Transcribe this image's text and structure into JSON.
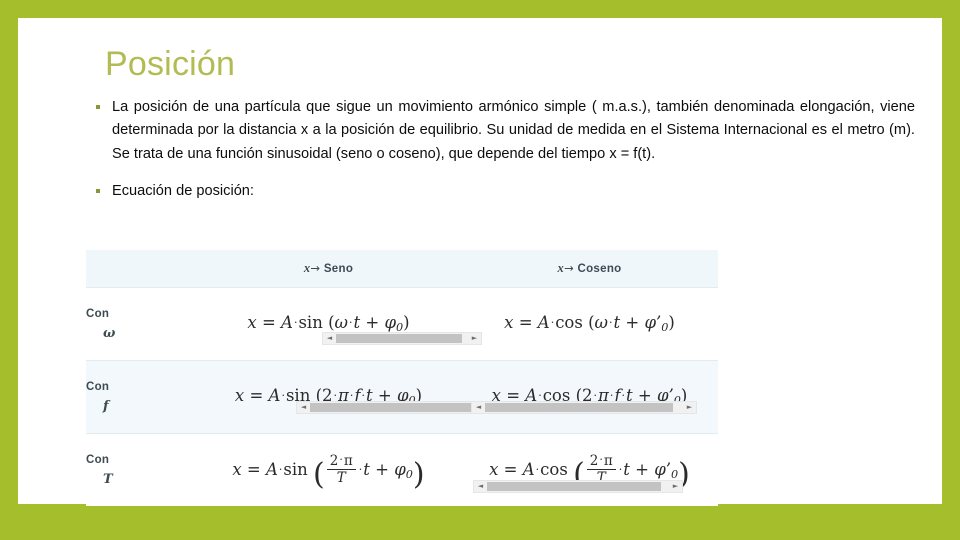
{
  "theme": {
    "frame_color": "#A4BE2C",
    "title_color": "#B2BC52",
    "bullet_color": "#8B9639",
    "table_header_bg": "#F0F7FA",
    "table_tint_bg": "#F2F8FB",
    "scrollbar_thumb": "#C3C3C3"
  },
  "slide": {
    "title": "Posición",
    "bullets": [
      {
        "text": "La posición de una partícula que sigue un movimiento armónico simple ( m.a.s.), también denominada elongación, viene determinada por la distancia x a la posición de equilibrio. Su unidad de medida en el Sistema Internacional es el metro (m). Se trata de una función sinusoidal (seno o coseno), que depende del tiempo x = f(t).",
        "justified": true
      },
      {
        "text": "Ecuación de posición:",
        "justified": false
      }
    ]
  },
  "table": {
    "headers": {
      "label_column": "",
      "sine_variable": "x",
      "sine_arrow": "→",
      "sine_label": "Seno",
      "cosine_variable": "x",
      "cosine_arrow": "→",
      "cosine_label": "Coseno"
    },
    "rows": [
      {
        "con_label": "Con",
        "con_symbol": "ω",
        "sine_formula": "x = A · sin (ω · t + φ₀)",
        "cosine_formula": "x = A · cos (ω · t + φ'₀)",
        "sine_has_scrollbar": true,
        "cosine_has_scrollbar": false
      },
      {
        "con_label": "Con",
        "con_symbol": "f",
        "sine_formula": "x = A · sin (2 · π · f · t + φ₀)",
        "cosine_formula": "x = A · cos (2 · π · f · t + φ'₀)",
        "sine_has_scrollbar": true,
        "cosine_has_scrollbar": true
      },
      {
        "con_label": "Con",
        "con_symbol": "T",
        "sine_formula": "x = A · sin (2 · π / T · t + φ₀)",
        "cosine_formula": "x = A · cos (2 · π / T · t + φ'₀)",
        "sine_has_scrollbar": false,
        "cosine_has_scrollbar": true
      }
    ],
    "scrollbar": {
      "left_arrow": "◄",
      "right_arrow": "►"
    }
  }
}
